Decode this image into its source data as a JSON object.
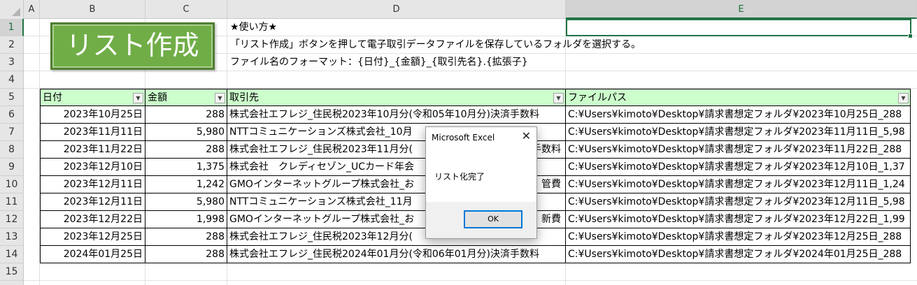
{
  "columns": [
    "A",
    "B",
    "C",
    "D",
    "E"
  ],
  "rows": [
    "1",
    "2",
    "3",
    "4",
    "5",
    "6",
    "7",
    "8",
    "9",
    "10",
    "11",
    "12",
    "13",
    "14",
    "15"
  ],
  "button": {
    "label": "リスト作成"
  },
  "instructions": {
    "heading": "★使い方★",
    "line1": "「リスト作成」ボタンを押して電子取引データファイルを保存しているフォルダを選択する。",
    "line2": "ファイル名のフォーマット：{日付}_{金額}_{取引先名}.{拡張子}"
  },
  "table": {
    "headers": {
      "date": "日付",
      "amount": "金額",
      "vendor": "取引先",
      "path": "ファイルパス"
    },
    "rows": [
      {
        "date": "2023年10月25日",
        "amount": "288",
        "vendor": "株式会社エフレジ_住民税2023年10月分(令和05年10月分)決済手数料",
        "path": "C:¥Users¥kimoto¥Desktop¥請求書想定フォルダ¥2023年10月25日_288"
      },
      {
        "date": "2023年11月11日",
        "amount": "5,980",
        "vendor": "NTTコミュニケーションズ株式会社_10月",
        "path": "C:¥Users¥kimoto¥Desktop¥請求書想定フォルダ¥2023年11月11日_5,98"
      },
      {
        "date": "2023年11月22日",
        "amount": "288",
        "vendor": "株式会社エフレジ_住民税2023年11月分(",
        "vendor_tail": "手数料",
        "path": "C:¥Users¥kimoto¥Desktop¥請求書想定フォルダ¥2023年11月22日_288"
      },
      {
        "date": "2023年12月10日",
        "amount": "1,375",
        "vendor": "株式会社　クレディセゾン_UCカード年会",
        "path": "C:¥Users¥kimoto¥Desktop¥請求書想定フォルダ¥2023年12月10日_1,37"
      },
      {
        "date": "2023年12月11日",
        "amount": "1,242",
        "vendor": "GMOインターネットグループ株式会社_お",
        "vendor_tail": "管費",
        "path": "C:¥Users¥kimoto¥Desktop¥請求書想定フォルダ¥2023年12月11日_1,24"
      },
      {
        "date": "2023年12月11日",
        "amount": "5,980",
        "vendor": "NTTコミュニケーションズ株式会社_11月",
        "path": "C:¥Users¥kimoto¥Desktop¥請求書想定フォルダ¥2023年12月11日_5,98"
      },
      {
        "date": "2023年12月22日",
        "amount": "1,998",
        "vendor": "GMOインターネットグループ株式会社_お",
        "vendor_tail": "新費",
        "path": "C:¥Users¥kimoto¥Desktop¥請求書想定フォルダ¥2023年12月22日_1,99"
      },
      {
        "date": "2023年12月25日",
        "amount": "288",
        "vendor": "株式会社エフレジ_住民税2023年12月分(",
        "path": "C:¥Users¥kimoto¥Desktop¥請求書想定フォルダ¥2023年12月25日_288"
      },
      {
        "date": "2024年01月25日",
        "amount": "288",
        "vendor": "株式会社エフレジ_住民税2024年01月分(令和06年01月分)決済手数料",
        "path": "C:¥Users¥kimoto¥Desktop¥請求書想定フォルダ¥2024年01月25日_288"
      }
    ]
  },
  "dialog": {
    "title": "Microsoft Excel",
    "message": "リスト化完了",
    "ok_label": "OK",
    "close_glyph": "✕"
  },
  "colors": {
    "accent": "#217346",
    "button": "#70ad47",
    "header_fill": "#ccffcc"
  }
}
